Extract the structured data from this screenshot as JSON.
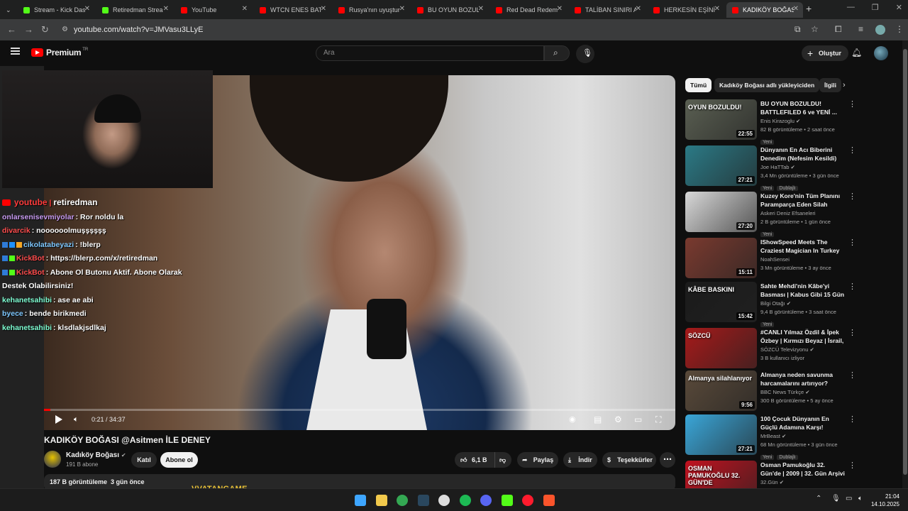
{
  "browser": {
    "tabs": [
      {
        "label": "Stream - Kick Das",
        "favicon_color": "#53fc18"
      },
      {
        "label": "Retiredman Strea",
        "favicon_color": "#53fc18"
      },
      {
        "label": "YouTube",
        "favicon_color": "#ff0000"
      },
      {
        "label": "WTCN ENES BATU",
        "favicon_color": "#ff0000"
      },
      {
        "label": "Rusya'nın uyuştur",
        "favicon_color": "#ff0000"
      },
      {
        "label": "BU OYUN BOZULD",
        "favicon_color": "#ff0000"
      },
      {
        "label": "Red Dead Redemp",
        "favicon_color": "#ff0000"
      },
      {
        "label": "TALİBAN SINIRI A",
        "favicon_color": "#ff0000"
      },
      {
        "label": "HERKESİN EŞİNİ K",
        "favicon_color": "#ff0000"
      },
      {
        "label": "KADIKÖY BOĞASI",
        "favicon_color": "#ff0000"
      }
    ],
    "url": "youtube.com/watch?v=JMVasu3LLyE"
  },
  "youtube": {
    "logo_text": "Premium",
    "logo_superscript": "TR",
    "search_placeholder": "Ara",
    "create_label": "Oluştur"
  },
  "player": {
    "time_current": "0:21",
    "time_total": "34:37",
    "progress_fraction": 0.01
  },
  "overlay": {
    "platform": "youtube",
    "handle": "retiredman",
    "chat": [
      {
        "user": "onlarsenisevmiyolar",
        "msg": ": Ror noldu la",
        "color": "#c79bf2",
        "badges": []
      },
      {
        "user": "divarcik",
        "msg": ": noooooolmuşşşşşş",
        "color": "#ff4d4d",
        "badges": []
      },
      {
        "user": "cikolatabeyazi",
        "msg": ": !blerp",
        "color": "#7ec8ff",
        "badges": [
          "#2f7bd8",
          "#1e90ff",
          "#f5a623"
        ]
      },
      {
        "user": "KickBot",
        "msg": ": https://blerp.com/x/retiredman",
        "color": "#ff4d4d",
        "badges": [
          "#2f7bd8",
          "#53fc18"
        ]
      },
      {
        "user": "KickBot",
        "msg": ": Abone Ol Butonu Aktif. Abone Olarak",
        "color": "#ff4d4d",
        "badges": [
          "#2f7bd8",
          "#53fc18"
        ]
      },
      {
        "user": "",
        "msg": "Destek Olabilirsiniz!",
        "color": "#ffffff",
        "badges": []
      },
      {
        "user": "kehanetsahibi",
        "msg": ": ase ae abi",
        "color": "#7fffd4",
        "badges": []
      },
      {
        "user": "byece",
        "msg": ": bende birikmedi",
        "color": "#7ec8ff",
        "badges": []
      },
      {
        "user": "kehanetsahibi",
        "msg": ": klsdlakjsdlkaj",
        "color": "#7fffd4",
        "badges": []
      }
    ]
  },
  "video": {
    "title": "KADIKÖY BOĞASI @Asitmen İLE DENEY",
    "channel": "Kadıköy Boğası",
    "subscribers": "191 B abone",
    "join_label": "Katıl",
    "subscribe_label": "Abone ol",
    "likes": "6,1 B",
    "share_label": "Paylaş",
    "download_label": "İndir",
    "thanks_label": "Teşekkürler",
    "views": "187 B görüntüleme",
    "published": "3 gün önce"
  },
  "sidebar": {
    "chips": [
      {
        "label": "Tümü",
        "active": true
      },
      {
        "label": "Kadıköy Boğası adlı yükleyiciden",
        "active": false
      },
      {
        "label": "İlgili",
        "active": false
      }
    ],
    "items": [
      {
        "title": "BU OYUN BOZULDU! BATTLEFILED 6 ve YENİ ...",
        "channel": "Enis Kirazoglu",
        "verified": true,
        "views": "82 B görüntüleme",
        "age": "2 saat önce",
        "duration": "22:55",
        "tags": [
          "Yeni"
        ],
        "thumb_text": "OYUN BOZULDU!",
        "thumb_bg": "#5a5f52"
      },
      {
        "title": "Dünyanın En Acı Biberini Denedim (Nefesim Kesildi)",
        "channel": "Joe HaTTab",
        "verified": true,
        "views": "3,4 Mn görüntüleme",
        "age": "3 gün önce",
        "duration": "27:21",
        "tags": [
          "Yeni",
          "Dublajlı"
        ],
        "thumb_text": "",
        "thumb_bg": "#2b7a86"
      },
      {
        "title": "Kuzey Kore'nin Tüm Planını Paramparça Eden Silah",
        "channel": "Askeri Deniz Efsaneleri",
        "verified": false,
        "views": "2 B görüntüleme",
        "age": "1 gün önce",
        "duration": "27:20",
        "tags": [
          "Yeni"
        ],
        "thumb_text": "",
        "thumb_bg": "#d8d8d8"
      },
      {
        "title": "IShowSpeed Meets The Craziest Magician In Turkey 🇹🇷",
        "channel": "NoahSensei",
        "verified": false,
        "views": "3 Mn görüntüleme",
        "age": "3 ay önce",
        "duration": "15:11",
        "tags": [],
        "thumb_text": "",
        "thumb_bg": "#7a3a2f"
      },
      {
        "title": "Sahte Mehdi'nin Kâbe'yi Basması | Kabus Gibi 15 Gün",
        "channel": "Bilgi Otağı",
        "verified": true,
        "views": "9,4 B görüntüleme",
        "age": "3 saat önce",
        "duration": "15:42",
        "tags": [
          "Yeni"
        ],
        "thumb_text": "KÂBE BASKINI",
        "thumb_bg": "#1b1b1b"
      },
      {
        "title": "#CANLI Yılmaz Özdil & İpek Özbey | Kırmızı Beyaz | İsrail, ...",
        "channel": "SÖZCÜ Televizyonu",
        "verified": true,
        "views": "3 B kullanıcı izliyor",
        "age": "",
        "duration": "",
        "tags": [],
        "thumb_text": "SÖZCÜ",
        "thumb_bg": "#a61a1a"
      },
      {
        "title": "Almanya neden savunma harcamalarını artırıyor?",
        "channel": "BBC News Türkçe",
        "verified": true,
        "views": "300 B görüntüleme",
        "age": "5 ay önce",
        "duration": "9:56",
        "tags": [],
        "thumb_text": "Almanya silahlanıyor",
        "thumb_bg": "#5a4a3a"
      },
      {
        "title": "100 Çocuk Dünyanın En Güçlü Adamına Karşı!",
        "channel": "MrBeast",
        "verified": true,
        "views": "68 Mn görüntüleme",
        "age": "3 gün önce",
        "duration": "27:21",
        "tags": [
          "Yeni",
          "Dublajlı"
        ],
        "thumb_text": "",
        "thumb_bg": "#3aa6d8"
      },
      {
        "title": "Osman Pamukoğlu 32. Gün'de | 2009 | 32. Gün Arşivi",
        "channel": "32.Gün",
        "verified": true,
        "views": "",
        "age": "",
        "duration": "",
        "tags": [],
        "thumb_text": "OSMAN PAMUKOĞLU 32. GÜN'DE",
        "thumb_bg": "#c1121f"
      }
    ]
  },
  "watermark": "VVATANGAME",
  "taskbar": {
    "time": "21:04",
    "date": "14.10.2025",
    "apps": [
      {
        "name": "windows-start",
        "color": "#3ea6ff"
      },
      {
        "name": "file-explorer",
        "color": "#f2c94c"
      },
      {
        "name": "chrome",
        "color": "#34a853"
      },
      {
        "name": "steam",
        "color": "#2a475e"
      },
      {
        "name": "obs",
        "color": "#ddd"
      },
      {
        "name": "spotify",
        "color": "#1db954"
      },
      {
        "name": "discord",
        "color": "#5865f2"
      },
      {
        "name": "kick",
        "color": "#53fc18"
      },
      {
        "name": "opera",
        "color": "#ff1b2d"
      },
      {
        "name": "brave",
        "color": "#fb542b"
      }
    ]
  }
}
